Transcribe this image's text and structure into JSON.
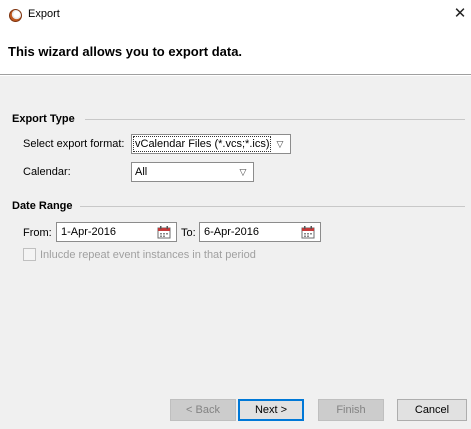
{
  "window": {
    "title": "Export",
    "close_icon": "close-icon"
  },
  "banner": {
    "text": "This wizard allows you to export data."
  },
  "export_type": {
    "heading": "Export Type",
    "format_label": "Select export format:",
    "format_value": "vCalendar Files (*.vcs;*.ics)",
    "calendar_label": "Calendar:",
    "calendar_value": "All"
  },
  "date_range": {
    "heading": "Date Range",
    "from_label": "From:",
    "from_value": "1-Apr-2016",
    "to_label": "To:",
    "to_value": "6-Apr-2016",
    "repeat_checkbox_label": "Inlucde repeat event instances in that period",
    "repeat_checked": false
  },
  "buttons": {
    "back": "< Back",
    "next": "Next >",
    "finish": "Finish",
    "cancel": "Cancel"
  },
  "colors": {
    "accent": "#0078d7",
    "app_icon": "#c0581e"
  }
}
